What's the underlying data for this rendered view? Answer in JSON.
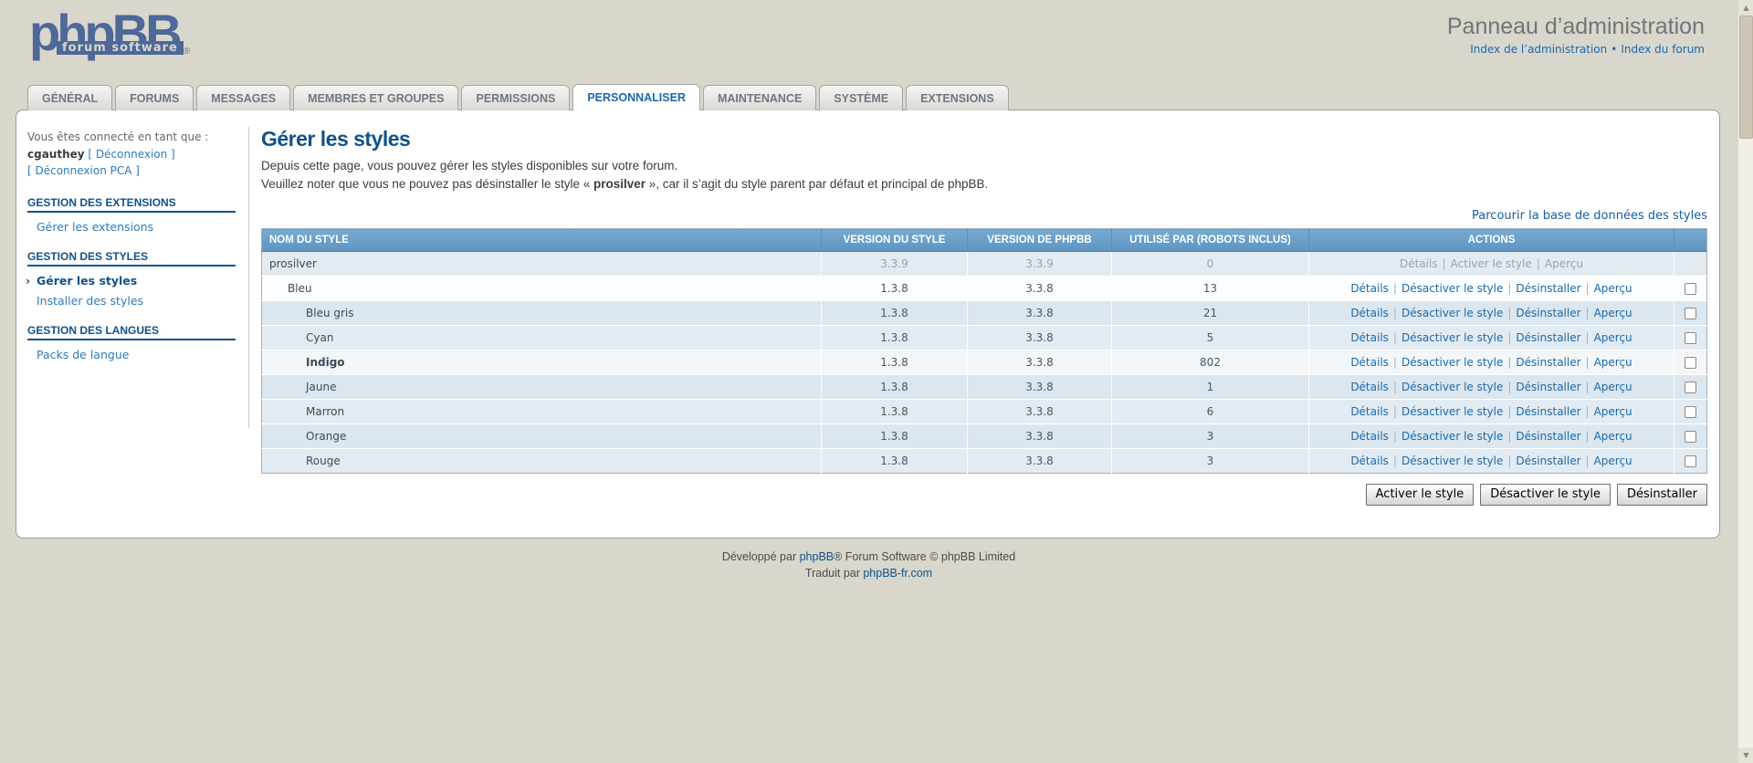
{
  "colors": {
    "page_bg": "#d9d6cc",
    "logo_blue": "#4d6899",
    "accent_blue": "#105289",
    "link_blue": "#1a6aac",
    "active_tab_text": "#1868ad",
    "table_header_top": "#75aad2",
    "table_header_bottom": "#5f94c1"
  },
  "header": {
    "logo_text": "phpBB",
    "logo_tagline": "forum software",
    "logo_reg": "®",
    "title": "Panneau d’administration",
    "breadcrumb": {
      "link1": "Index de l’administration",
      "sep": "•",
      "link2": "Index du forum"
    }
  },
  "tabs": [
    {
      "label": "GÉNÉRAL",
      "active": false
    },
    {
      "label": "FORUMS",
      "active": false
    },
    {
      "label": "MESSAGES",
      "active": false
    },
    {
      "label": "MEMBRES ET GROUPES",
      "active": false
    },
    {
      "label": "PERMISSIONS",
      "active": false
    },
    {
      "label": "PERSONNALISER",
      "active": true
    },
    {
      "label": "MAINTENANCE",
      "active": false
    },
    {
      "label": "SYSTÈME",
      "active": false
    },
    {
      "label": "EXTENSIONS",
      "active": false
    }
  ],
  "sidebar": {
    "connected_label": "Vous êtes connecté en tant que :",
    "username": "cgauthey",
    "logout_link": "[ Déconnexion ]",
    "logout_pca_link": "[ Déconnexion PCA ]",
    "sections": [
      {
        "title": "GESTION DES EXTENSIONS",
        "items": [
          {
            "label": "Gérer les extensions",
            "active": false
          }
        ]
      },
      {
        "title": "GESTION DES STYLES",
        "items": [
          {
            "label": "Gérer les styles",
            "active": true
          },
          {
            "label": "Installer des styles",
            "active": false
          }
        ]
      },
      {
        "title": "GESTION DES LANGUES",
        "items": [
          {
            "label": "Packs de langue",
            "active": false
          }
        ]
      }
    ],
    "active_arrow": "›"
  },
  "main": {
    "title": "Gérer les styles",
    "desc_line1": "Depuis cette page, vous pouvez gérer les styles disponibles sur votre forum.",
    "desc_line2_before": "Veuillez noter que vous ne pouvez pas désinstaller le style « ",
    "desc_line2_bold": "prosilver",
    "desc_line2_after": " », car il s’agit du style parent par défaut et principal de phpBB.",
    "browse_link": "Parcourir la base de données des styles",
    "table": {
      "headers": [
        "NOM DU STYLE",
        "VERSION DU STYLE",
        "VERSION DE PHPBB",
        "UTILISÉ PAR (ROBOTS INCLUS)",
        "ACTIONS"
      ],
      "action_separator": "|",
      "rows": [
        {
          "name": "prosilver",
          "indent": 0,
          "bold": false,
          "style_version": "3.3.9",
          "phpbb_version": "3.3.9",
          "used_by": "0",
          "actions": [
            "Détails",
            "Activer le style",
            "Aperçu"
          ],
          "checkbox": false,
          "shade": "muted"
        },
        {
          "name": "Bleu",
          "indent": 1,
          "bold": false,
          "style_version": "1.3.8",
          "phpbb_version": "3.3.8",
          "used_by": "13",
          "actions": [
            "Détails",
            "Désactiver le style",
            "Désinstaller",
            "Aperçu"
          ],
          "checkbox": true,
          "shade": "light"
        },
        {
          "name": "Bleu gris",
          "indent": 2,
          "bold": false,
          "style_version": "1.3.8",
          "phpbb_version": "3.3.8",
          "used_by": "21",
          "actions": [
            "Détails",
            "Désactiver le style",
            "Désinstaller",
            "Aperçu"
          ],
          "checkbox": true,
          "shade": "blue"
        },
        {
          "name": "Cyan",
          "indent": 2,
          "bold": false,
          "style_version": "1.3.8",
          "phpbb_version": "3.3.8",
          "used_by": "5",
          "actions": [
            "Détails",
            "Désactiver le style",
            "Désinstaller",
            "Aperçu"
          ],
          "checkbox": true,
          "shade": "blue2"
        },
        {
          "name": "Indigo",
          "indent": 2,
          "bold": true,
          "style_version": "1.3.8",
          "phpbb_version": "3.3.8",
          "used_by": "802",
          "actions": [
            "Détails",
            "Désactiver le style",
            "Désinstaller",
            "Aperçu"
          ],
          "checkbox": true,
          "shade": "light2"
        },
        {
          "name": "Jaune",
          "indent": 2,
          "bold": false,
          "style_version": "1.3.8",
          "phpbb_version": "3.3.8",
          "used_by": "1",
          "actions": [
            "Détails",
            "Désactiver le style",
            "Désinstaller",
            "Aperçu"
          ],
          "checkbox": true,
          "shade": "blue"
        },
        {
          "name": "Marron",
          "indent": 2,
          "bold": false,
          "style_version": "1.3.8",
          "phpbb_version": "3.3.8",
          "used_by": "6",
          "actions": [
            "Détails",
            "Désactiver le style",
            "Désinstaller",
            "Aperçu"
          ],
          "checkbox": true,
          "shade": "blue2"
        },
        {
          "name": "Orange",
          "indent": 2,
          "bold": false,
          "style_version": "1.3.8",
          "phpbb_version": "3.3.8",
          "used_by": "3",
          "actions": [
            "Détails",
            "Désactiver le style",
            "Désinstaller",
            "Aperçu"
          ],
          "checkbox": true,
          "shade": "blue"
        },
        {
          "name": "Rouge",
          "indent": 2,
          "bold": false,
          "style_version": "1.3.8",
          "phpbb_version": "3.3.8",
          "used_by": "3",
          "actions": [
            "Détails",
            "Désactiver le style",
            "Désinstaller",
            "Aperçu"
          ],
          "checkbox": true,
          "shade": "blue2"
        }
      ]
    },
    "buttons": [
      "Activer le style",
      "Désactiver le style",
      "Désinstaller"
    ]
  },
  "footer": {
    "line1_before": "Développé par ",
    "line1_link": "phpBB",
    "line1_after": "® Forum Software © phpBB Limited",
    "line2_before": "Traduit par ",
    "line2_link": "phpBB-fr.com"
  }
}
